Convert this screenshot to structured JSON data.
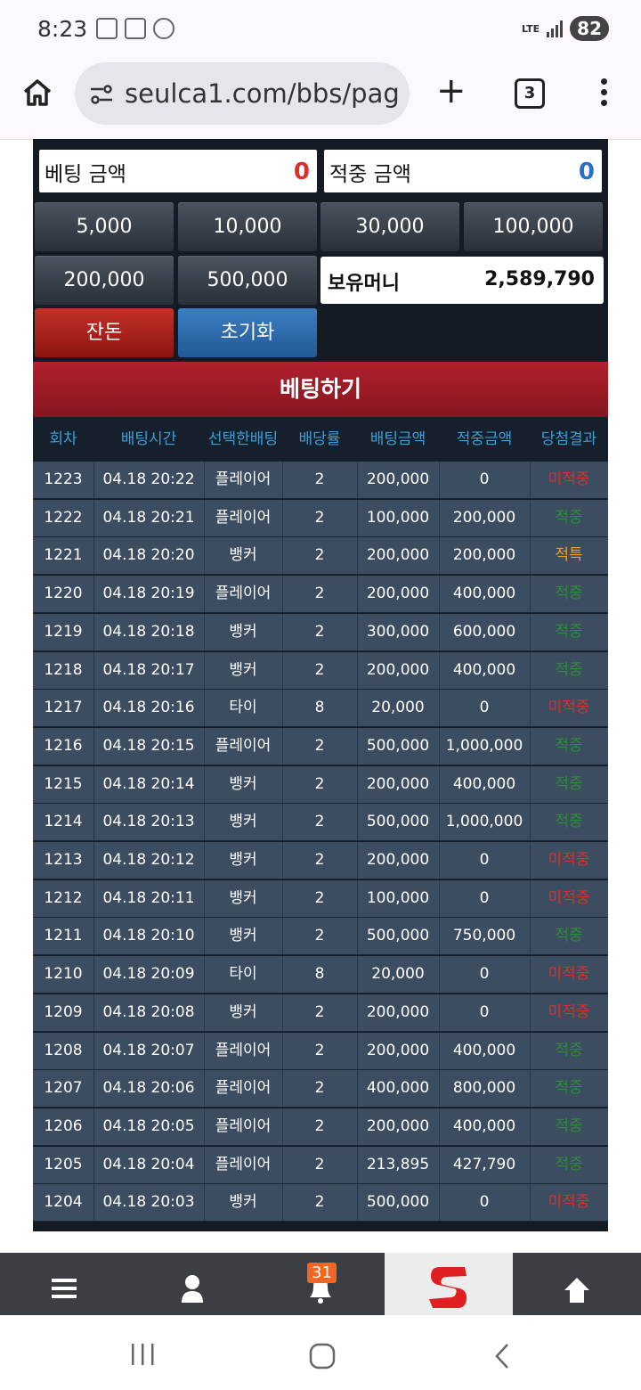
{
  "status_bar": {
    "time": "8:23",
    "network": "LTE",
    "battery": "82"
  },
  "browser": {
    "url": "seulca1.com/bbs/pag",
    "tab_count": "3"
  },
  "bet_panel": {
    "bet_amount_label": "베팅 금액",
    "bet_amount_value": "0",
    "win_amount_label": "적중 금액",
    "win_amount_value": "0",
    "chips": [
      "5,000",
      "10,000",
      "30,000",
      "100,000",
      "200,000",
      "500,000"
    ],
    "money_label": "보유머니",
    "money_value": "2,589,790",
    "change_button": "잔돈",
    "reset_button": "초기화",
    "bet_button": "베팅하기"
  },
  "table": {
    "headers": [
      "회차",
      "배팅시간",
      "선택한배팅",
      "배당률",
      "배팅금액",
      "적중금액",
      "당첨결과"
    ],
    "rows": [
      {
        "round": "1223",
        "time": "04.18 20:22",
        "pick": "플레이어",
        "odds": "2",
        "bet": "200,000",
        "win": "0",
        "result": "미적중"
      },
      {
        "round": "1222",
        "time": "04.18 20:21",
        "pick": "플레이어",
        "odds": "2",
        "bet": "100,000",
        "win": "200,000",
        "result": "적중"
      },
      {
        "round": "1221",
        "time": "04.18 20:20",
        "pick": "뱅커",
        "odds": "2",
        "bet": "200,000",
        "win": "200,000",
        "result": "적특"
      },
      {
        "round": "1220",
        "time": "04.18 20:19",
        "pick": "플레이어",
        "odds": "2",
        "bet": "200,000",
        "win": "400,000",
        "result": "적중"
      },
      {
        "round": "1219",
        "time": "04.18 20:18",
        "pick": "뱅커",
        "odds": "2",
        "bet": "300,000",
        "win": "600,000",
        "result": "적중"
      },
      {
        "round": "1218",
        "time": "04.18 20:17",
        "pick": "뱅커",
        "odds": "2",
        "bet": "200,000",
        "win": "400,000",
        "result": "적중"
      },
      {
        "round": "1217",
        "time": "04.18 20:16",
        "pick": "타이",
        "odds": "8",
        "bet": "20,000",
        "win": "0",
        "result": "미적중"
      },
      {
        "round": "1216",
        "time": "04.18 20:15",
        "pick": "플레이어",
        "odds": "2",
        "bet": "500,000",
        "win": "1,000,000",
        "result": "적중"
      },
      {
        "round": "1215",
        "time": "04.18 20:14",
        "pick": "뱅커",
        "odds": "2",
        "bet": "200,000",
        "win": "400,000",
        "result": "적중"
      },
      {
        "round": "1214",
        "time": "04.18 20:13",
        "pick": "뱅커",
        "odds": "2",
        "bet": "500,000",
        "win": "1,000,000",
        "result": "적중"
      },
      {
        "round": "1213",
        "time": "04.18 20:12",
        "pick": "뱅커",
        "odds": "2",
        "bet": "200,000",
        "win": "0",
        "result": "미적중"
      },
      {
        "round": "1212",
        "time": "04.18 20:11",
        "pick": "뱅커",
        "odds": "2",
        "bet": "100,000",
        "win": "0",
        "result": "미적중"
      },
      {
        "round": "1211",
        "time": "04.18 20:10",
        "pick": "뱅커",
        "odds": "2",
        "bet": "500,000",
        "win": "750,000",
        "result": "적중"
      },
      {
        "round": "1210",
        "time": "04.18 20:09",
        "pick": "타이",
        "odds": "8",
        "bet": "20,000",
        "win": "0",
        "result": "미적중"
      },
      {
        "round": "1209",
        "time": "04.18 20:08",
        "pick": "뱅커",
        "odds": "2",
        "bet": "200,000",
        "win": "0",
        "result": "미적중"
      },
      {
        "round": "1208",
        "time": "04.18 20:07",
        "pick": "플레이어",
        "odds": "2",
        "bet": "200,000",
        "win": "400,000",
        "result": "적중"
      },
      {
        "round": "1207",
        "time": "04.18 20:06",
        "pick": "플레이어",
        "odds": "2",
        "bet": "400,000",
        "win": "800,000",
        "result": "적중"
      },
      {
        "round": "1206",
        "time": "04.18 20:05",
        "pick": "플레이어",
        "odds": "2",
        "bet": "200,000",
        "win": "400,000",
        "result": "적중"
      },
      {
        "round": "1205",
        "time": "04.18 20:04",
        "pick": "플레이어",
        "odds": "2",
        "bet": "213,895",
        "win": "427,790",
        "result": "적중"
      },
      {
        "round": "1204",
        "time": "04.18 20:03",
        "pick": "뱅커",
        "odds": "2",
        "bet": "500,000",
        "win": "0",
        "result": "미적중"
      }
    ]
  },
  "bottom_nav": {
    "notification_count": "31",
    "icons": [
      "menu-icon",
      "user-icon",
      "bell-icon",
      "site-logo",
      "arrow-up-icon"
    ]
  },
  "colors": {
    "result_lose": "#d9302a",
    "result_win": "#2f8a3a",
    "result_special": "#f0a020",
    "amount_zero_bet": "#d9302a",
    "amount_zero_win": "#2a6fc8"
  }
}
